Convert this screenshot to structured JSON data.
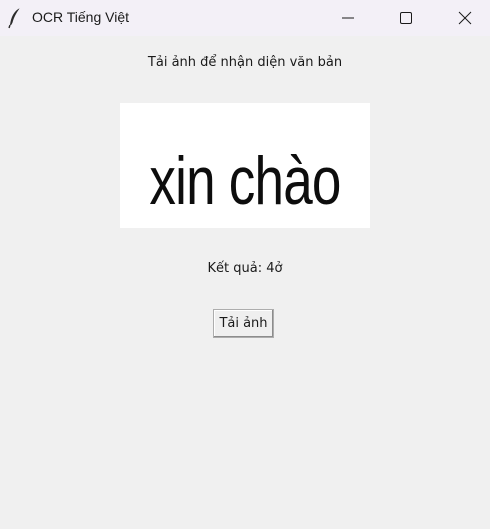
{
  "window": {
    "title": "OCR Tiếng Việt",
    "app_icon": "feather-icon",
    "controls": {
      "minimize_icon": "minimize-icon",
      "maximize_icon": "maximize-icon",
      "close_icon": "close-icon"
    }
  },
  "main": {
    "instruction": "Tải ảnh để nhận diện văn bản",
    "preview_text": "xin chào",
    "result_text": "Kết quả: 4ở",
    "upload_button_label": "Tải ảnh"
  },
  "colors": {
    "background": "#f0f0f0",
    "titlebar": "#f3f0f7",
    "preview_background": "#ffffff"
  }
}
